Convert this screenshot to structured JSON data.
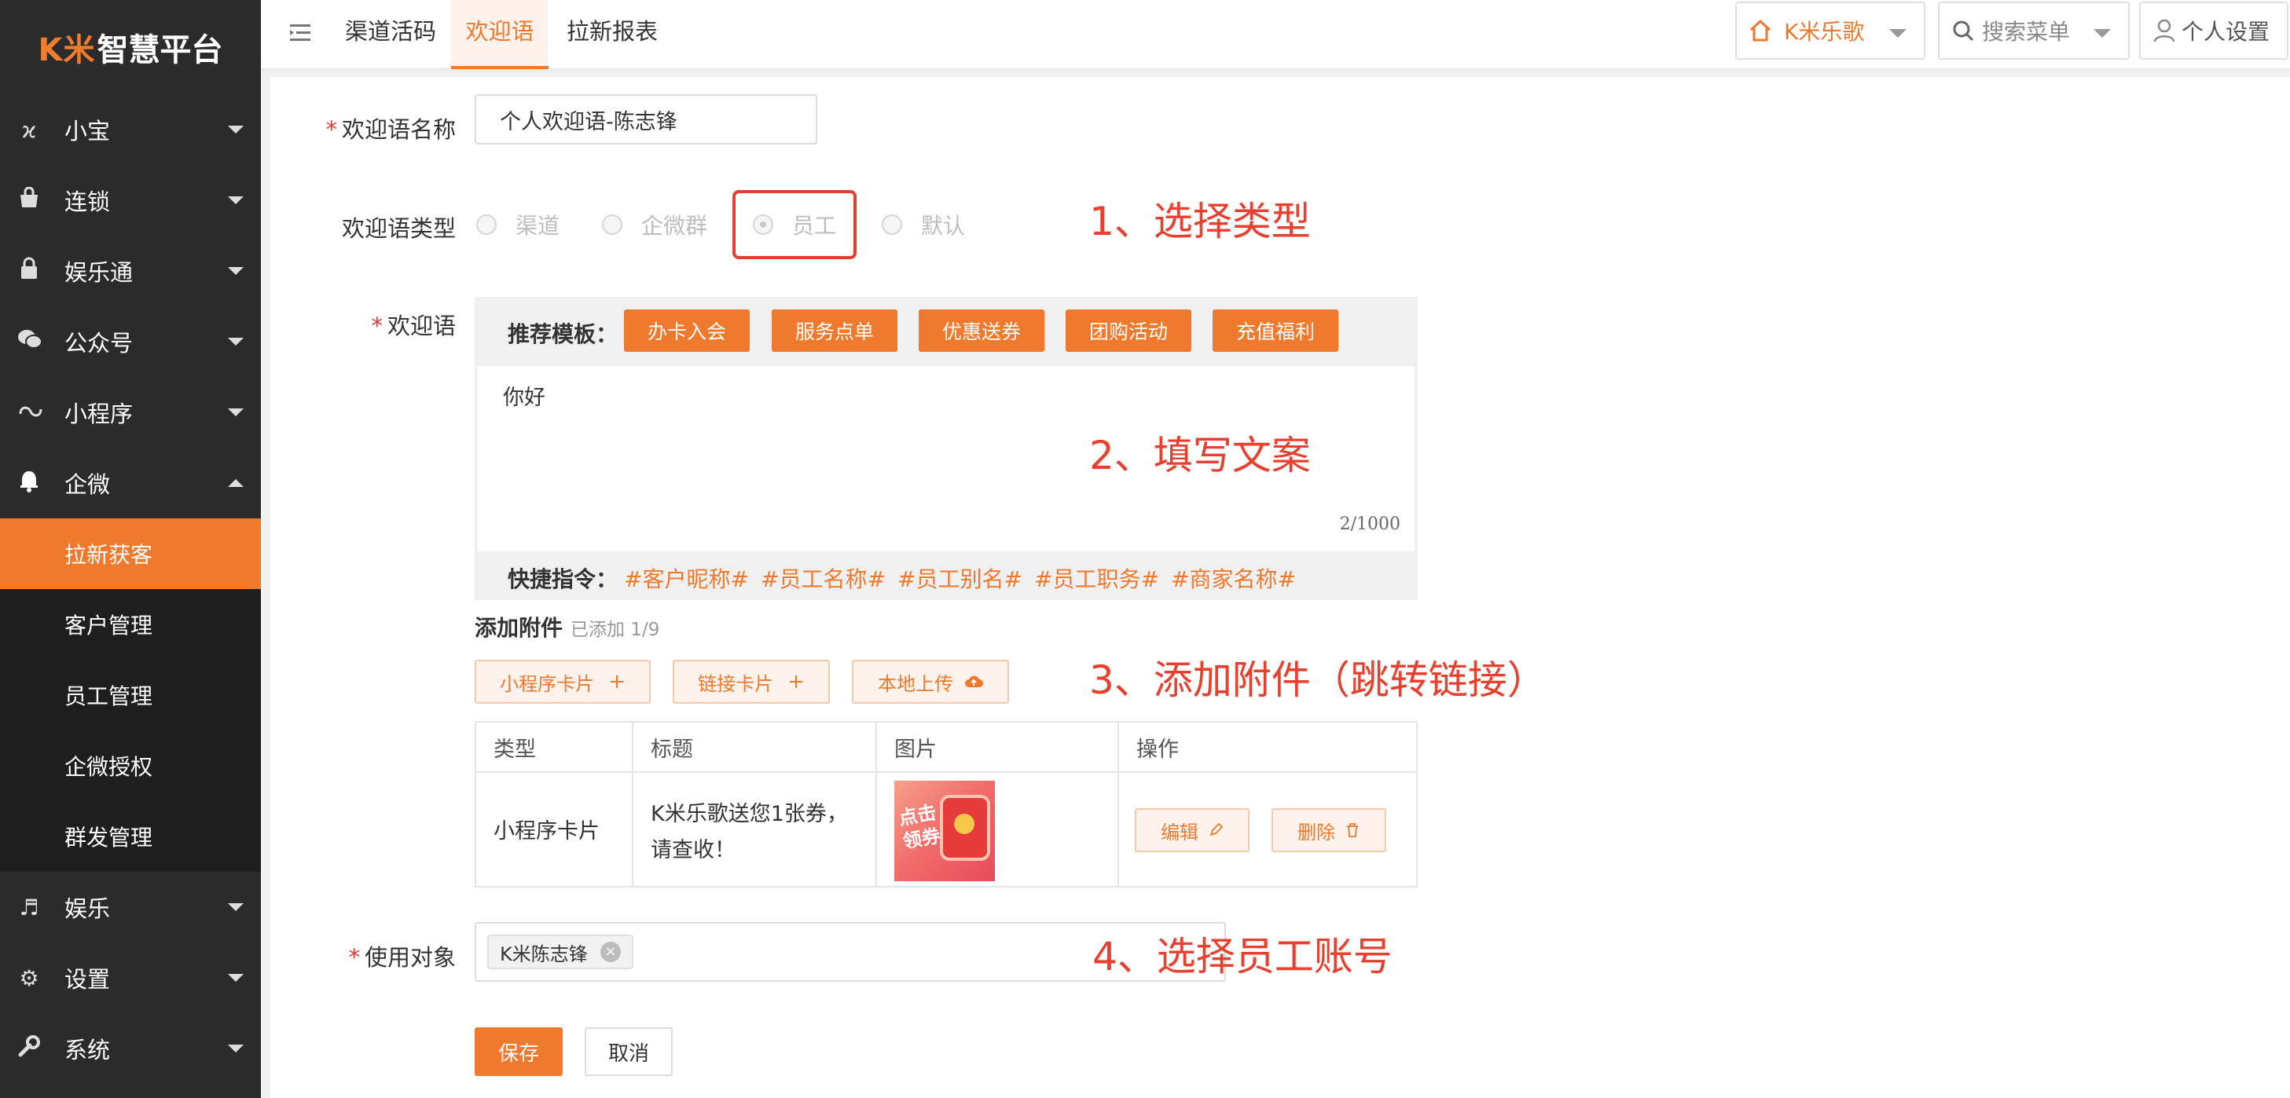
{
  "logo": {
    "brand": "K米",
    "title": "智慧平台"
  },
  "sidebar": {
    "items": [
      {
        "label": "小宝",
        "icon": "xiaobao-icon"
      },
      {
        "label": "连锁",
        "icon": "shop-bag-icon"
      },
      {
        "label": "娱乐通",
        "icon": "lock-icon"
      },
      {
        "label": "公众号",
        "icon": "wechat-icon"
      },
      {
        "label": "小程序",
        "icon": "mini-program-icon"
      },
      {
        "label": "企微",
        "icon": "bell-icon"
      }
    ],
    "sub_items": [
      "拉新获客",
      "客户管理",
      "员工管理",
      "企微授权",
      "群发管理"
    ],
    "bottom_items": [
      {
        "label": "娱乐",
        "icon": "music-icon"
      },
      {
        "label": "设置",
        "icon": "gears-icon"
      },
      {
        "label": "系统",
        "icon": "wrench-icon"
      }
    ]
  },
  "topbar": {
    "tabs": [
      "渠道活码",
      "欢迎语",
      "拉新报表"
    ],
    "store": "K米乐歌",
    "search": "搜索菜单",
    "user": "个人设置"
  },
  "form": {
    "name_label": "欢迎语名称",
    "name_value": "个人欢迎语-陈志锋",
    "type_label": "欢迎语类型",
    "type_options": [
      "渠道",
      "企微群",
      "员工",
      "默认"
    ],
    "type_selected": "员工",
    "welcome_label": "欢迎语",
    "template_label": "推荐模板：",
    "templates": [
      "办卡入会",
      "服务点单",
      "优惠送券",
      "团购活动",
      "充值福利"
    ],
    "welcome_text": "你好",
    "char_count": "2/1000",
    "shortcut_label": "快捷指令：",
    "shortcuts": [
      "#客户昵称#",
      "#员工名称#",
      "#员工别名#",
      "#员工职务#",
      "#商家名称#"
    ],
    "attach_title": "添加附件",
    "attach_count": "已添加 1/9",
    "attach_buttons": [
      "小程序卡片",
      "链接卡片",
      "本地上传"
    ],
    "table": {
      "headers": [
        "类型",
        "标题",
        "图片",
        "操作"
      ],
      "rows": [
        {
          "type": "小程序卡片",
          "title": "K米乐歌送您1张券，请查收！",
          "image_text": "点击领券",
          "actions": [
            "编辑",
            "删除"
          ]
        }
      ]
    },
    "target_label": "使用对象",
    "target_tag": "K米陈志锋",
    "save": "保存",
    "cancel": "取消"
  },
  "annotations": [
    "1、选择类型",
    "2、填写文案",
    "3、添加附件（跳转链接）",
    "4、选择员工账号"
  ],
  "colors": {
    "accent": "#ef7a2d",
    "sidebar": "#2b2b2b",
    "annotation": "#e8402f"
  }
}
